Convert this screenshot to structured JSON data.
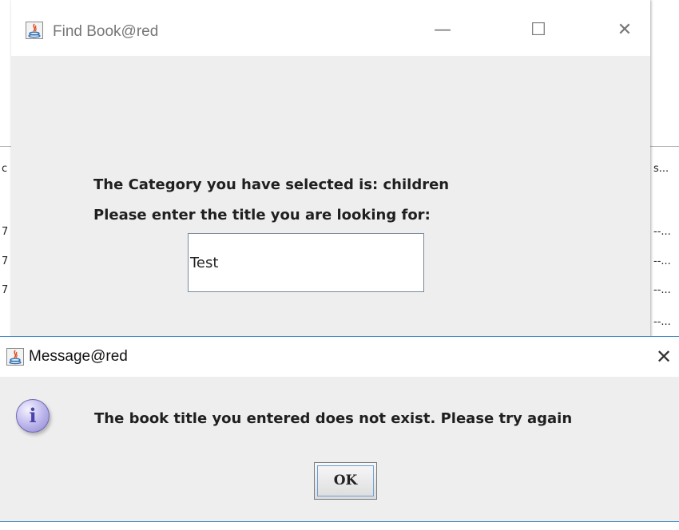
{
  "background_window": {
    "column_fragments": [
      "c",
      "s...",
      "7",
      "7",
      "7",
      "--...",
      "--...",
      "--...",
      "--..."
    ]
  },
  "find_window": {
    "title": "Find Book@red",
    "minimize_glyph": "—",
    "maximize_glyph": "☐",
    "close_glyph": "✕",
    "category_label": "The Category you have selected is: children",
    "prompt_label": "Please enter the title you are looking for:",
    "title_input_value": "Test"
  },
  "message_window": {
    "title": "Message@red",
    "close_glyph": "✕",
    "info_glyph": "i",
    "message": "The book title you entered does not exist. Please try again",
    "ok_label": "OK"
  }
}
